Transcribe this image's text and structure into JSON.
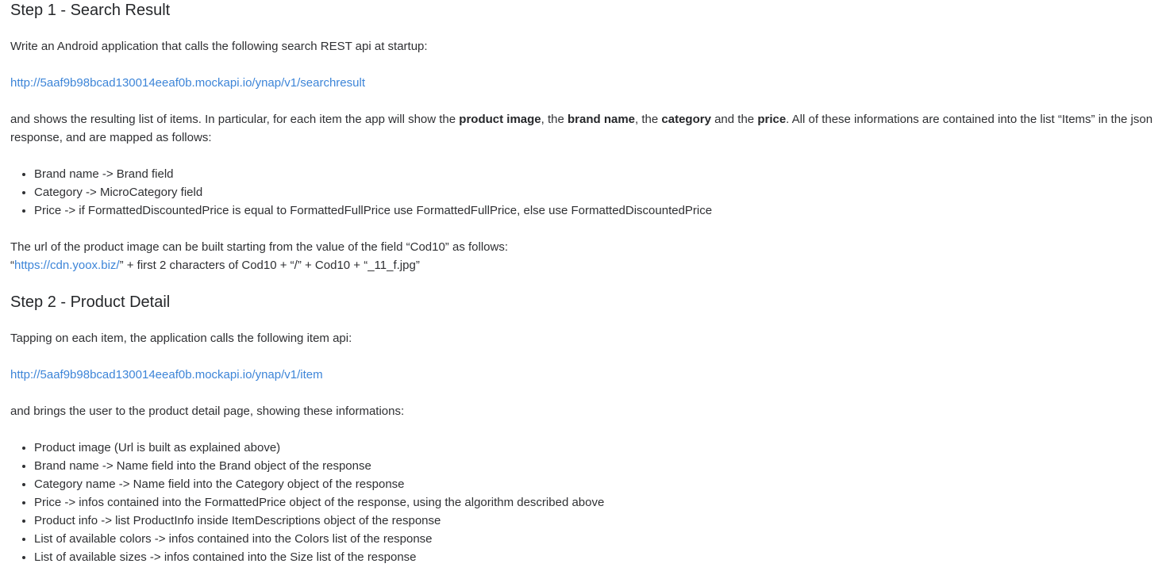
{
  "step1": {
    "title": "Step 1 - Search Result",
    "intro": "Write an Android application that calls the following search REST api at startup:",
    "api_url": "http://5aaf9b98bcad130014eeaf0b.mockapi.io/ynap/v1/searchresult",
    "desc": {
      "t1": "and shows the resulting list of items. In particular, for each item the app will show the ",
      "b1": "product image",
      "t2": ", the ",
      "b2": "brand name",
      "t3": ", the ",
      "b3": "category",
      "t4": " and the ",
      "b4": "price",
      "t5": ". All of these informations are contained into the list “Items” in the json response, and are mapped as follows:"
    },
    "mappings": [
      "Brand name -> Brand field",
      "Category -> MicroCategory field",
      "Price -> if FormattedDiscountedPrice is equal to FormattedFullPrice use FormattedFullPrice, else use FormattedDiscountedPrice"
    ],
    "image_note": {
      "line1": "The url of the product image can be built starting from the value of the field “Cod10” as follows:",
      "quote_open": "“",
      "cdn_url": "https://cdn.yoox.biz/",
      "rest": "” + first 2 characters of Cod10 + “/” + Cod10 + “_11_f.jpg”"
    }
  },
  "step2": {
    "title": "Step 2 - Product Detail",
    "intro": "Tapping on each item, the application calls the following item api:",
    "api_url": "http://5aaf9b98bcad130014eeaf0b.mockapi.io/ynap/v1/item",
    "desc": "and brings the user to the product detail page, showing these informations:",
    "items": [
      "Product image (Url is built as explained above)",
      "Brand name -> Name field into the Brand object of the response",
      "Category name -> Name field into the Category object of the response",
      "Price -> infos contained into the FormattedPrice object of the response, using the algorithm described above",
      "Product info -> list ProductInfo inside ItemDescriptions object of the response",
      "List of available colors -> infos contained into the Colors list of the response",
      "List of available sizes -> infos contained into the Size list of the response"
    ]
  },
  "colors": {
    "link": "#3d85d8",
    "text": "#2f3033"
  }
}
